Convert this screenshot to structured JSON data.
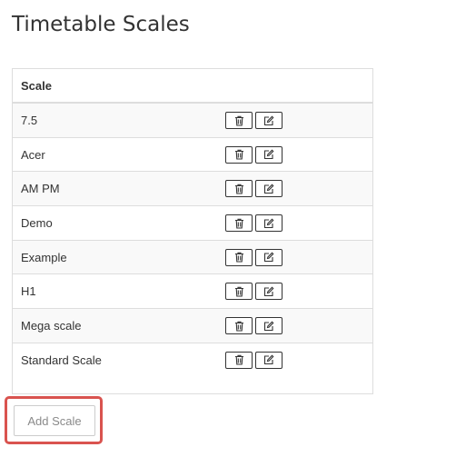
{
  "page": {
    "title": "Timetable Scales"
  },
  "table": {
    "header": "Scale",
    "rows": [
      {
        "name": "7.5"
      },
      {
        "name": "Acer"
      },
      {
        "name": "AM PM"
      },
      {
        "name": "Demo"
      },
      {
        "name": "Example"
      },
      {
        "name": "H1"
      },
      {
        "name": "Mega scale"
      },
      {
        "name": "Standard Scale"
      }
    ],
    "row_actions": [
      "trash-icon",
      "edit-icon"
    ]
  },
  "actions": {
    "add_label": "Add Scale"
  },
  "colors": {
    "highlight_border": "#d9534f",
    "row_alt": "#f9f9f9",
    "border": "#dddddd"
  }
}
